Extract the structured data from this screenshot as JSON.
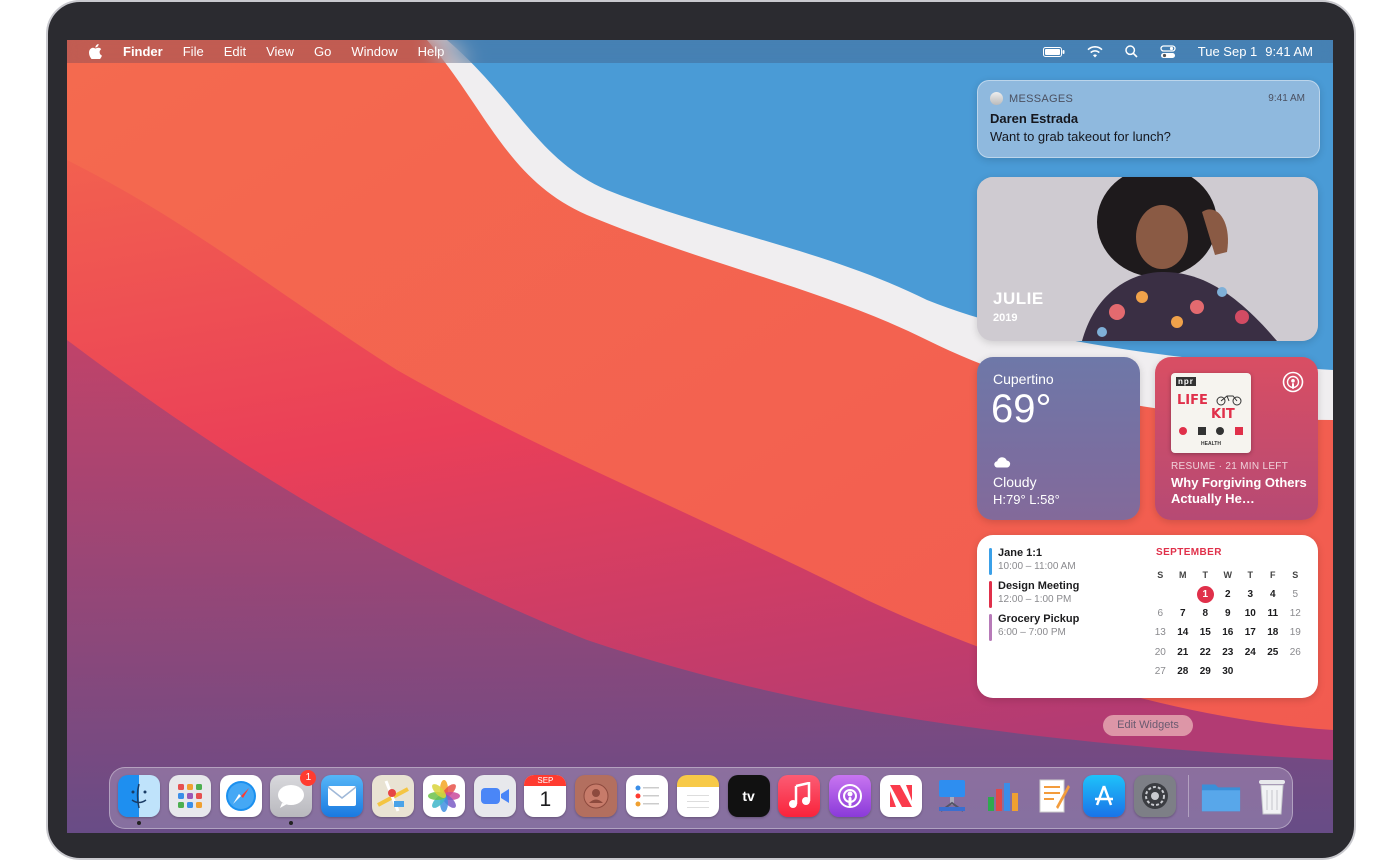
{
  "menubar": {
    "app_name": "Finder",
    "menus": [
      "File",
      "Edit",
      "View",
      "Go",
      "Window",
      "Help"
    ],
    "date": "Tue Sep 1",
    "time": "9:41 AM"
  },
  "notification": {
    "app": "MESSAGES",
    "time": "9:41 AM",
    "sender": "Daren Estrada",
    "message": "Want to grab takeout for lunch?"
  },
  "photo_widget": {
    "name": "JULIE",
    "year": "2019"
  },
  "weather_widget": {
    "city": "Cupertino",
    "temperature": "69°",
    "condition": "Cloudy",
    "high_low": "H:79° L:58°",
    "icon": "cloud-icon"
  },
  "podcast_widget": {
    "cover_brand": "npr",
    "cover_title_1": "LIFE",
    "cover_title_2": "KIT",
    "cover_category": "HEALTH",
    "status": "RESUME · 21 MIN LEFT",
    "episode_title": "Why Forgiving Others Actually He…"
  },
  "calendar_widget": {
    "events": [
      {
        "title": "Jane 1:1",
        "time": "10:00 – 11:00 AM",
        "color": "#3aa0e8"
      },
      {
        "title": "Design Meeting",
        "time": "12:00 – 1:00 PM",
        "color": "#e0304a"
      },
      {
        "title": "Grocery Pickup",
        "time": "6:00 – 7:00 PM",
        "color": "#b77ab8"
      }
    ],
    "month": "SEPTEMBER",
    "weekdays": [
      "S",
      "M",
      "T",
      "W",
      "T",
      "F",
      "S"
    ],
    "weeks": [
      [
        "",
        "",
        "1",
        "2",
        "3",
        "4",
        "5"
      ],
      [
        "6",
        "7",
        "8",
        "9",
        "10",
        "11",
        "12"
      ],
      [
        "13",
        "14",
        "15",
        "16",
        "17",
        "18",
        "19"
      ],
      [
        "20",
        "21",
        "22",
        "23",
        "24",
        "25",
        "26"
      ],
      [
        "27",
        "28",
        "29",
        "30",
        "",
        "",
        ""
      ]
    ],
    "today": "1"
  },
  "edit_widgets_label": "Edit Widgets",
  "dock": {
    "items": [
      {
        "name": "finder",
        "icon": "finder-icon",
        "running": true
      },
      {
        "name": "launchpad",
        "icon": "launchpad-icon"
      },
      {
        "name": "safari",
        "icon": "safari-icon"
      },
      {
        "name": "messages",
        "icon": "messages-icon",
        "badge": "1",
        "running": true
      },
      {
        "name": "mail",
        "icon": "mail-icon"
      },
      {
        "name": "maps",
        "icon": "maps-icon"
      },
      {
        "name": "photos",
        "icon": "photos-icon"
      },
      {
        "name": "facetime",
        "icon": "facetime-icon"
      },
      {
        "name": "calendar",
        "icon": "calendar-icon",
        "month": "SEP",
        "day": "1"
      },
      {
        "name": "contacts",
        "icon": "contacts-icon"
      },
      {
        "name": "reminders",
        "icon": "reminders-icon"
      },
      {
        "name": "notes",
        "icon": "notes-icon"
      },
      {
        "name": "tv",
        "icon": "apple-tv-icon",
        "label": "tv"
      },
      {
        "name": "music",
        "icon": "music-icon"
      },
      {
        "name": "podcasts",
        "icon": "podcasts-icon"
      },
      {
        "name": "news",
        "icon": "news-icon"
      },
      {
        "name": "keynote",
        "icon": "keynote-icon"
      },
      {
        "name": "numbers",
        "icon": "numbers-icon"
      },
      {
        "name": "pages",
        "icon": "pages-icon"
      },
      {
        "name": "app-store",
        "icon": "app-store-icon"
      },
      {
        "name": "system-preferences",
        "icon": "system-preferences-icon"
      }
    ],
    "trailing": [
      {
        "name": "downloads-folder",
        "icon": "folder-icon"
      },
      {
        "name": "trash",
        "icon": "trash-icon"
      }
    ]
  }
}
